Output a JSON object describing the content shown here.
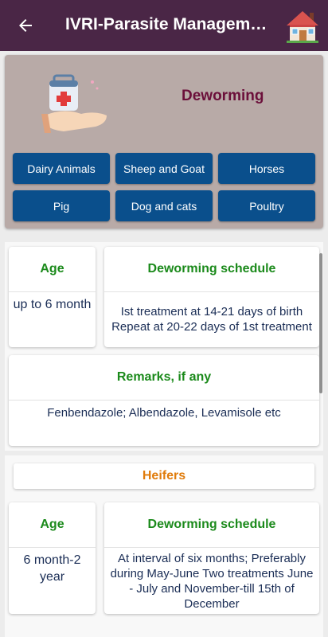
{
  "app_bar": {
    "title": "IVRI-Parasite Management",
    "back_icon": "arrow-left-icon",
    "home_icon": "house-icon"
  },
  "header": {
    "title": "Deworming",
    "icon": "medical-kit-in-hand-icon",
    "buttons": [
      {
        "label": "Dairy Animals"
      },
      {
        "label": "Sheep and Goat"
      },
      {
        "label": "Horses"
      },
      {
        "label": "Pig"
      },
      {
        "label": "Dog and cats"
      },
      {
        "label": "Poultry"
      }
    ]
  },
  "sections": [
    {
      "title": "",
      "age_header": "Age",
      "schedule_header": "Deworming schedule",
      "age_value": "up to 6 month",
      "schedule_value": "Ist treatment at 14-21 days of birth Repeat at 20-22 days of 1st treatment",
      "remarks_header": "Remarks, if any",
      "remarks_value": "Fenbendazole; Albendazole, Levamisole etc"
    },
    {
      "title": "Heifers",
      "age_header": "Age",
      "schedule_header": "Deworming schedule",
      "age_value": "6 month-2 year",
      "schedule_value": "At interval of six months; Preferably during May-June  Two treatments June - July and November-till 15th of December"
    }
  ],
  "colors": {
    "app_bar": "#4a2646",
    "header_card": "#b8aaa7",
    "button": "#0a4f8c",
    "hero_title": "#6b0f3a",
    "column_header": "#1b8a1b",
    "section_title": "#e07b0a",
    "body_text": "#1a2d55"
  }
}
